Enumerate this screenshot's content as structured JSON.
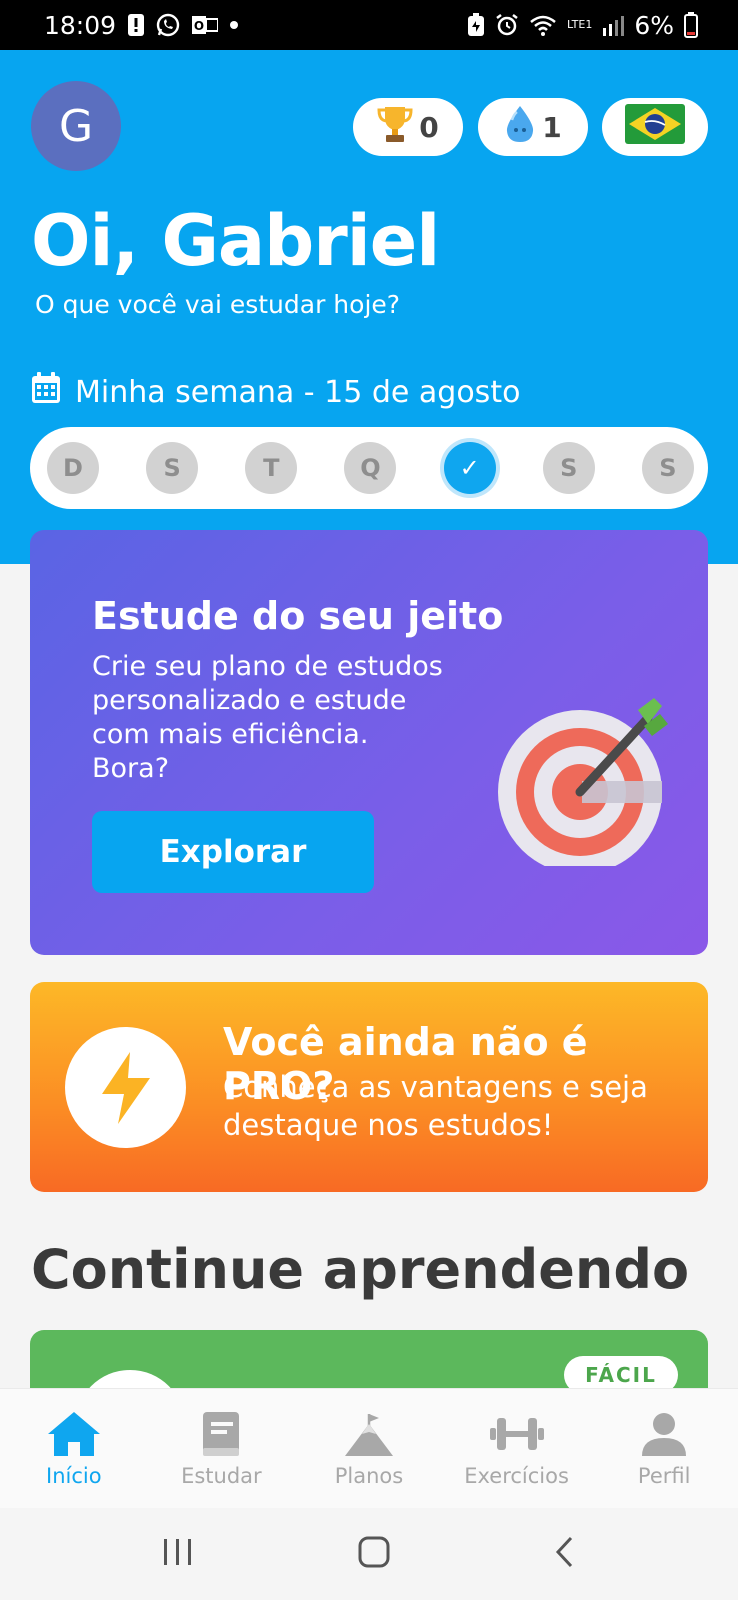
{
  "status_bar": {
    "time": "18:09",
    "battery": "6%",
    "network": "LTE1"
  },
  "header": {
    "avatar_letter": "G",
    "trophy_count": "0",
    "drop_count": "1",
    "greeting": "Oi, Gabriel",
    "subtitle": "O que você vai estudar hoje?",
    "week_label": "Minha semana - 15 de agosto",
    "week_days": [
      "D",
      "S",
      "T",
      "Q",
      "✓",
      "S",
      "S"
    ]
  },
  "study_card": {
    "title": "Estude do seu jeito",
    "description": "Crie seu plano de estudos\npersonalizado e estude\ncom mais eficiência.\nBora?",
    "button_label": "Explorar"
  },
  "pro_card": {
    "title": "Você ainda não é PRO?",
    "description": "Conheça as vantagens e seja\ndestaque nos estudos!"
  },
  "section": {
    "title": "Continue aprendendo"
  },
  "course_card": {
    "difficulty": "FÁCIL"
  },
  "bottom_nav": {
    "items": [
      {
        "label": "Início",
        "icon": "home-icon"
      },
      {
        "label": "Estudar",
        "icon": "book-icon"
      },
      {
        "label": "Planos",
        "icon": "mountain-icon"
      },
      {
        "label": "Exercícios",
        "icon": "dumbbell-icon"
      },
      {
        "label": "Perfil",
        "icon": "person-icon"
      }
    ]
  },
  "colors": {
    "primary": "#07a5f0",
    "study_card": "#6a60e6",
    "pro_card": "#fb8c24",
    "course_card": "#5cb85c"
  }
}
